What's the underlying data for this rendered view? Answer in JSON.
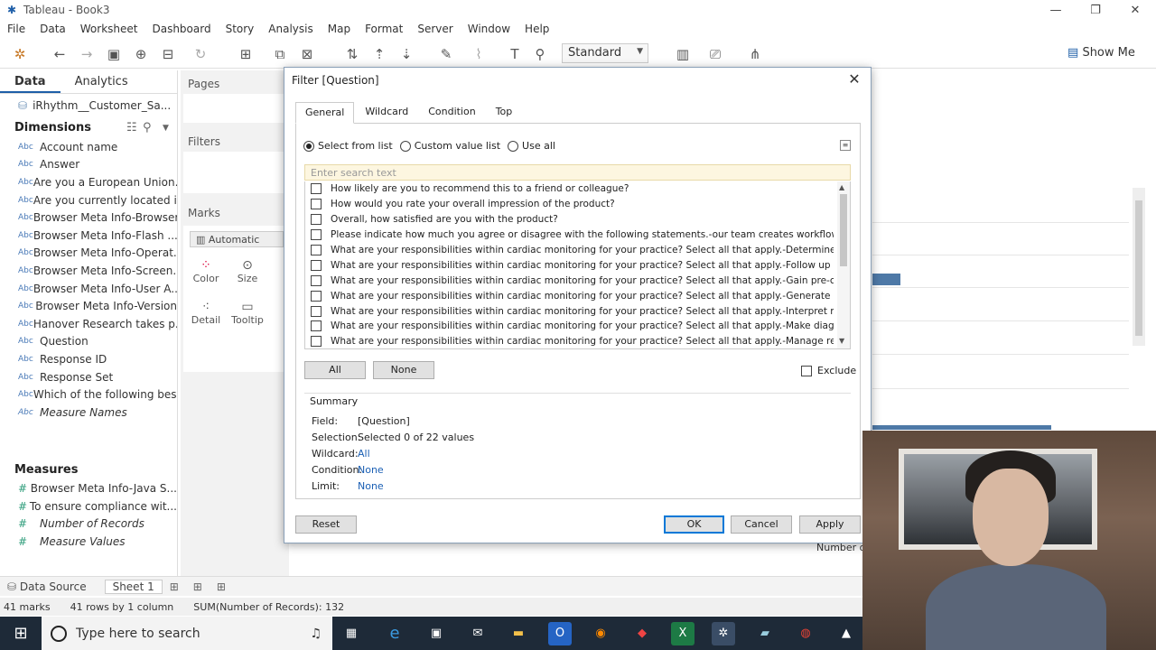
{
  "window": {
    "title": "Tableau - Book3"
  },
  "menu": [
    "File",
    "Data",
    "Worksheet",
    "Dashboard",
    "Story",
    "Analysis",
    "Map",
    "Format",
    "Server",
    "Window",
    "Help"
  ],
  "toolbar": {
    "fit_select": "Standard",
    "show_me": "Show Me"
  },
  "datapane": {
    "tab_data": "Data",
    "tab_analytics": "Analytics",
    "datasource": "iRhythm__Customer_Sa...",
    "dimensions_header": "Dimensions",
    "dimensions": [
      "Account name",
      "Answer",
      "Are you a European Union...",
      "Are you currently located i...",
      "Browser Meta Info-Browser",
      "Browser Meta Info-Flash ...",
      "Browser Meta Info-Operat...",
      "Browser Meta Info-Screen...",
      "Browser Meta Info-User A...",
      "Browser Meta Info-Version",
      "Hanover Research takes p...",
      "Question",
      "Response ID",
      "Response Set",
      "Which of the following bes...",
      "Measure Names"
    ],
    "measures_header": "Measures",
    "measures": [
      "Browser Meta Info-Java S...",
      "To ensure compliance wit...",
      "Number of Records",
      "Measure Values"
    ]
  },
  "shelves": {
    "pages": "Pages",
    "filters": "Filters",
    "marks": "Marks",
    "mark_type": "Automatic",
    "color": "Color",
    "size": "Size",
    "detail": "Detail",
    "tooltip": "Tooltip"
  },
  "sheetbar": {
    "datasource": "Data Source",
    "sheet": "Sheet 1"
  },
  "statusbar": {
    "marks": "41 marks",
    "rows": "41 rows by 1 column",
    "sum": "SUM(Number of Records): 132"
  },
  "axis_label": "Number o",
  "taskbar": {
    "search": "Type here to search"
  },
  "dialog": {
    "title": "Filter [Question]",
    "tabs": [
      "General",
      "Wildcard",
      "Condition",
      "Top"
    ],
    "radio_select_list": "Select from list",
    "radio_custom": "Custom value list",
    "radio_all": "Use all",
    "search_placeholder": "Enter search text",
    "items": [
      "How likely are you to recommend this to a friend or colleague?",
      "How would you rate your overall impression of the product?",
      "Overall, how satisfied are you with the product?",
      "Please indicate how much you agree or disagree with the following statements.-our team creates workflow efficiencies in o...",
      "What are your responsibilities within cardiac monitoring for your practice? Select all that apply.-Determine which monitoring t",
      "What are your responsibilities within cardiac monitoring for your practice? Select all that apply.-Follow up on payments",
      "What are your responsibilities within cardiac monitoring for your practice? Select all that apply.-Gain pre-clearance from insu",
      "What are your responsibilities within cardiac monitoring for your practice? Select all that apply.-Generate patient bill",
      "What are your responsibilities within cardiac monitoring for your practice? Select all that apply.-Interpret monitoring reports",
      "What are your responsibilities within cardiac monitoring for your practice? Select all that apply.-Make diagnosis",
      "What are your responsibilities within cardiac monitoring for your practice? Select all that apply.-Manage report process (pull"
    ],
    "btn_all": "All",
    "btn_none": "None",
    "exclude": "Exclude",
    "summary": {
      "head": "Summary",
      "field_k": "Field:",
      "field_v": "[Question]",
      "selection_k": "Selection:",
      "selection_v": "Selected 0 of 22 values",
      "wildcard_k": "Wildcard:",
      "wildcard_v": "All",
      "condition_k": "Condition:",
      "condition_v": "None",
      "limit_k": "Limit:",
      "limit_v": "None"
    },
    "btn_reset": "Reset",
    "btn_ok": "OK",
    "btn_cancel": "Cancel",
    "btn_apply": "Apply"
  }
}
